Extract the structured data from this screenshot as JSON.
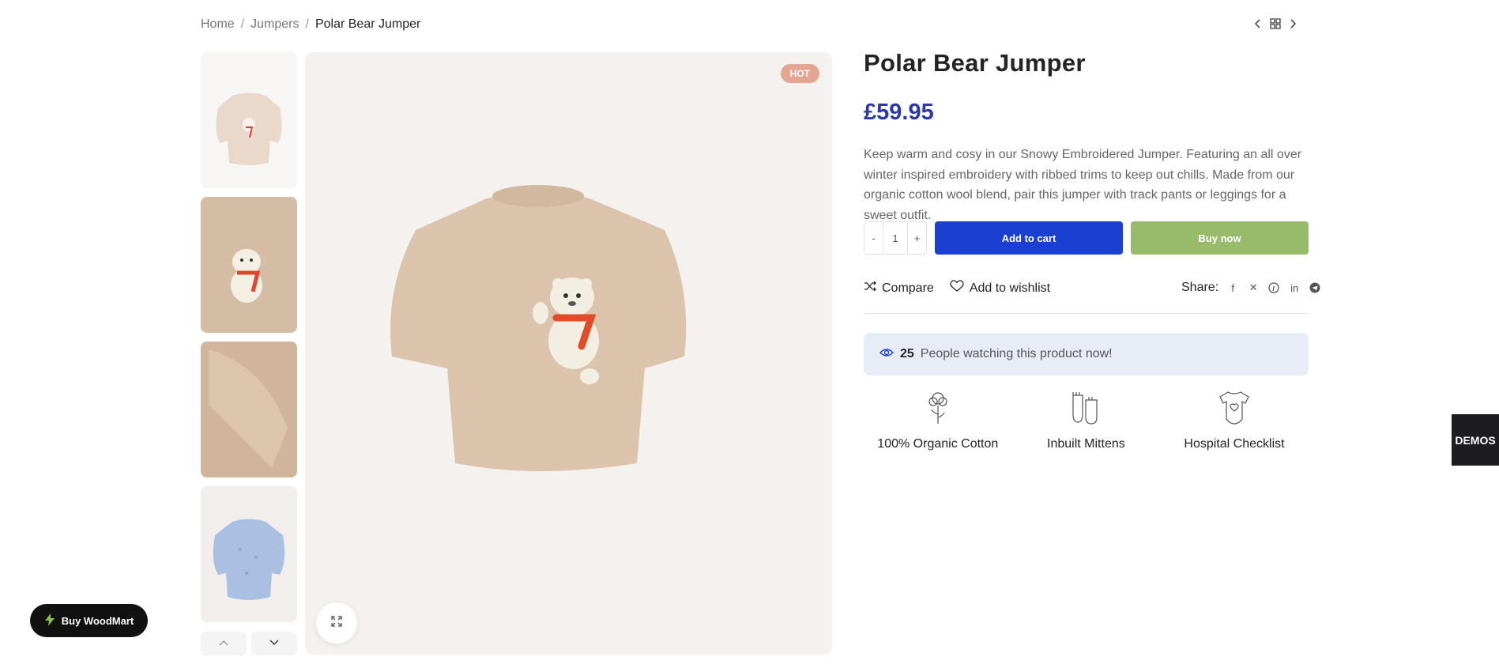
{
  "breadcrumb": {
    "home": "Home",
    "separator": "/",
    "category": "Jumpers",
    "current": "Polar Bear Jumper"
  },
  "product_nav": {
    "prev_icon": "chevron-left-icon",
    "grid_icon": "grid-icon",
    "next_icon": "chevron-right-icon"
  },
  "gallery": {
    "thumbnails": [
      "Polar bear jumper front cream",
      "Polar bear jumper close-up",
      "Polar bear jumper sleeve detail",
      "Blue knitted jumper"
    ],
    "badge": "HOT",
    "zoom_icon": "expand-icon"
  },
  "product": {
    "title": "Polar Bear Jumper",
    "price": "£59.95",
    "description": "Keep warm and cosy in our Snowy Embroidered Jumper. Featuring an all over winter inspired embroidery with ribbed trims to keep out chills. Made from our organic cotton wool blend, pair this jumper with track pants or leggings for a sweet outfit.",
    "quantity": {
      "minus": "-",
      "value": "1",
      "plus": "+"
    },
    "add_to_cart": "Add to cart",
    "buy_now": "Buy now"
  },
  "actions": {
    "compare": "Compare",
    "wishlist": "Add to wishlist",
    "share_label": "Share:"
  },
  "watching": {
    "count": "25",
    "text": "People watching this product now!"
  },
  "features": [
    {
      "label": "100% Organic Cotton",
      "icon": "cotton-flower-icon"
    },
    {
      "label": "Inbuilt Mittens",
      "icon": "mittens-icon"
    },
    {
      "label": "Hospital Checklist",
      "icon": "baby-bodysuit-icon"
    }
  ],
  "widgets": {
    "demos": "DEMOS",
    "buy_woodmart": "Buy WoodMart"
  },
  "colors": {
    "price": "#2b3aa8",
    "add_to_cart": "#1b3fd1",
    "buy_now": "#97bb6b",
    "hot_badge": "#e4a592",
    "watching_bg": "#e8ecf7"
  }
}
